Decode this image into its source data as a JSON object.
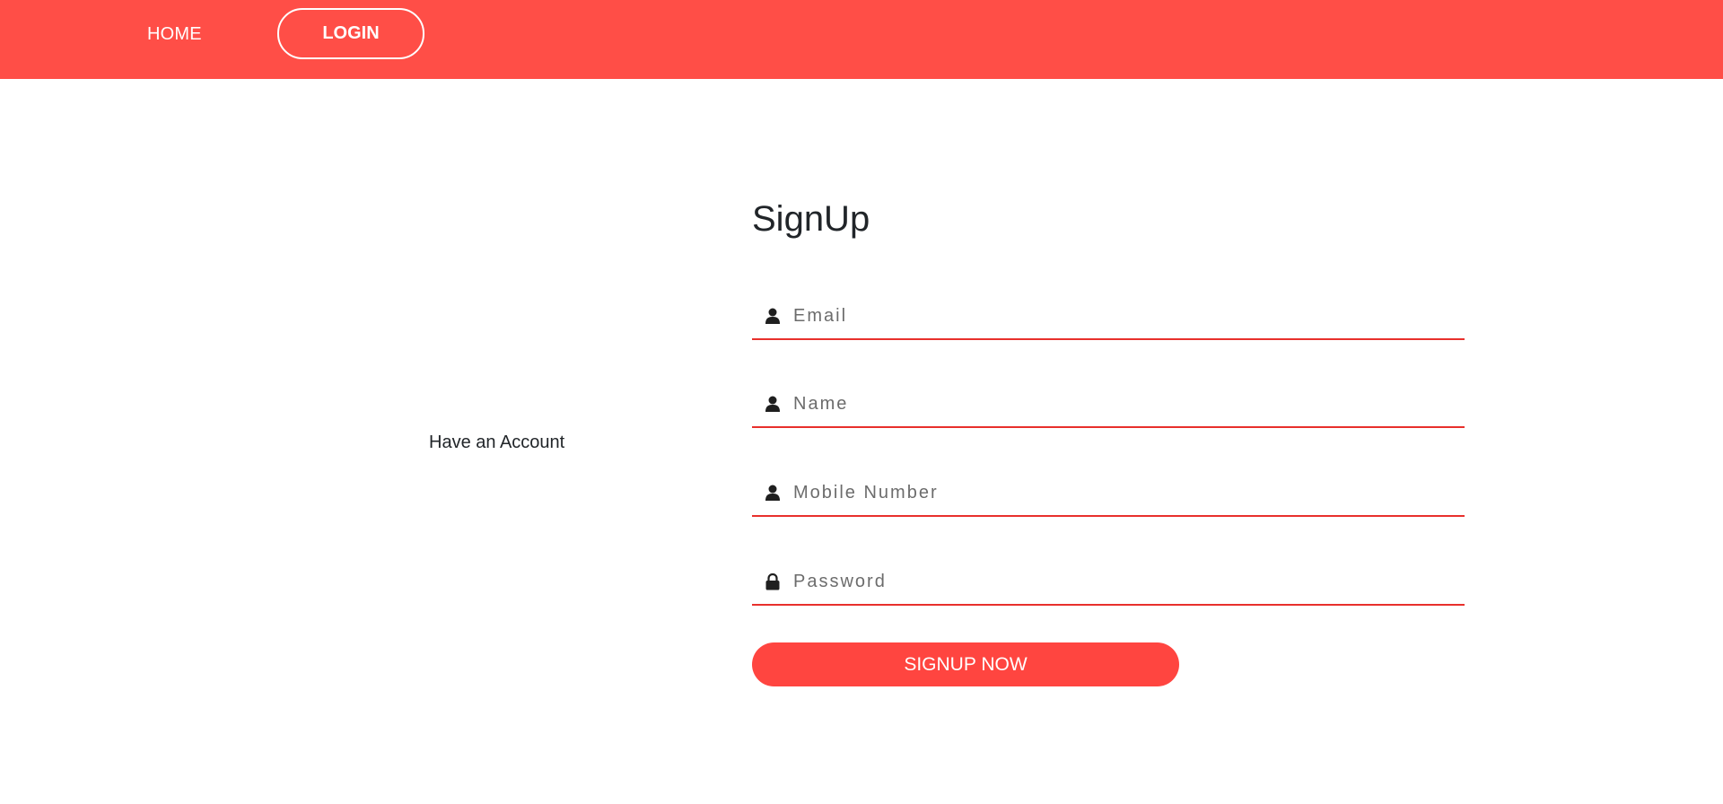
{
  "nav": {
    "home_label": "HOME",
    "login_label": "LOGIN"
  },
  "side": {
    "have_account": "Have an Account"
  },
  "form": {
    "title": "SignUp",
    "fields": [
      {
        "placeholder": "Email",
        "value": "",
        "icon": "user-icon"
      },
      {
        "placeholder": "Name",
        "value": "",
        "icon": "user-icon"
      },
      {
        "placeholder": "Mobile Number",
        "value": "",
        "icon": "user-icon"
      },
      {
        "placeholder": "Password",
        "value": "",
        "icon": "lock-icon"
      }
    ],
    "submit_label": "SIGNUP NOW"
  },
  "colors": {
    "navbar": "#ff4e47",
    "accent_underline": "#e8302c",
    "button": "#ff4540"
  }
}
